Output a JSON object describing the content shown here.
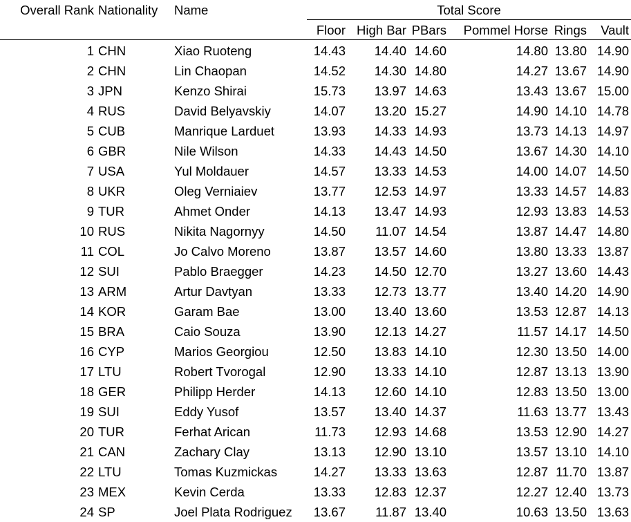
{
  "table": {
    "headers": {
      "rank": "Overall Rank",
      "nationality": "Nationality",
      "name": "Name",
      "group": "Total Score",
      "floor": "Floor",
      "highbar": "High Bar",
      "pbars": "PBars",
      "pommel": "Pommel Horse",
      "rings": "Rings",
      "vault": "Vault"
    },
    "rows": [
      {
        "rank": "1",
        "nat": "CHN",
        "name": "Xiao Ruoteng",
        "floor": "14.43",
        "highbar": "14.40",
        "pbars": "14.60",
        "pommel": "14.80",
        "rings": "13.80",
        "vault": "14.90"
      },
      {
        "rank": "2",
        "nat": "CHN",
        "name": "Lin Chaopan",
        "floor": "14.52",
        "highbar": "14.30",
        "pbars": "14.80",
        "pommel": "14.27",
        "rings": "13.67",
        "vault": "14.90"
      },
      {
        "rank": "3",
        "nat": "JPN",
        "name": "Kenzo Shirai",
        "floor": "15.73",
        "highbar": "13.97",
        "pbars": "14.63",
        "pommel": "13.43",
        "rings": "13.67",
        "vault": "15.00"
      },
      {
        "rank": "4",
        "nat": "RUS",
        "name": "David Belyavskiy",
        "floor": "14.07",
        "highbar": "13.20",
        "pbars": "15.27",
        "pommel": "14.90",
        "rings": "14.10",
        "vault": "14.78"
      },
      {
        "rank": "5",
        "nat": "CUB",
        "name": "Manrique Larduet",
        "floor": "13.93",
        "highbar": "14.33",
        "pbars": "14.93",
        "pommel": "13.73",
        "rings": "14.13",
        "vault": "14.97"
      },
      {
        "rank": "6",
        "nat": "GBR",
        "name": "Nile Wilson",
        "floor": "14.33",
        "highbar": "14.43",
        "pbars": "14.50",
        "pommel": "13.67",
        "rings": "14.30",
        "vault": "14.10"
      },
      {
        "rank": "7",
        "nat": "USA",
        "name": "Yul Moldauer",
        "floor": "14.57",
        "highbar": "13.33",
        "pbars": "14.53",
        "pommel": "14.00",
        "rings": "14.07",
        "vault": "14.50"
      },
      {
        "rank": "8",
        "nat": "UKR",
        "name": "Oleg Verniaiev",
        "floor": "13.77",
        "highbar": "12.53",
        "pbars": "14.97",
        "pommel": "13.33",
        "rings": "14.57",
        "vault": "14.83"
      },
      {
        "rank": "9",
        "nat": "TUR",
        "name": "Ahmet Onder",
        "floor": "14.13",
        "highbar": "13.47",
        "pbars": "14.93",
        "pommel": "12.93",
        "rings": "13.83",
        "vault": "14.53"
      },
      {
        "rank": "10",
        "nat": "RUS",
        "name": "Nikita Nagornyy",
        "floor": "14.50",
        "highbar": "11.07",
        "pbars": "14.54",
        "pommel": "13.87",
        "rings": "14.47",
        "vault": "14.80"
      },
      {
        "rank": "11",
        "nat": "COL",
        "name": "Jo Calvo Moreno",
        "floor": "13.87",
        "highbar": "13.57",
        "pbars": "14.60",
        "pommel": "13.80",
        "rings": "13.33",
        "vault": "13.87"
      },
      {
        "rank": "12",
        "nat": "SUI",
        "name": "Pablo Braegger",
        "floor": "14.23",
        "highbar": "14.50",
        "pbars": "12.70",
        "pommel": "13.27",
        "rings": "13.60",
        "vault": "14.43"
      },
      {
        "rank": "13",
        "nat": "ARM",
        "name": "Artur Davtyan",
        "floor": "13.33",
        "highbar": "12.73",
        "pbars": "13.77",
        "pommel": "13.40",
        "rings": "14.20",
        "vault": "14.90"
      },
      {
        "rank": "14",
        "nat": "KOR",
        "name": "Garam Bae",
        "floor": "13.00",
        "highbar": "13.40",
        "pbars": "13.60",
        "pommel": "13.53",
        "rings": "12.87",
        "vault": "14.13"
      },
      {
        "rank": "15",
        "nat": "BRA",
        "name": "Caio Souza",
        "floor": "13.90",
        "highbar": "12.13",
        "pbars": "14.27",
        "pommel": "11.57",
        "rings": "14.17",
        "vault": "14.50"
      },
      {
        "rank": "16",
        "nat": "CYP",
        "name": "Marios Georgiou",
        "floor": "12.50",
        "highbar": "13.83",
        "pbars": "14.10",
        "pommel": "12.30",
        "rings": "13.50",
        "vault": "14.00"
      },
      {
        "rank": "17",
        "nat": "LTU",
        "name": "Robert Tvorogal",
        "floor": "12.90",
        "highbar": "13.33",
        "pbars": "14.10",
        "pommel": "12.87",
        "rings": "13.13",
        "vault": "13.90"
      },
      {
        "rank": "18",
        "nat": "GER",
        "name": "Philipp Herder",
        "floor": "14.13",
        "highbar": "12.60",
        "pbars": "14.10",
        "pommel": "12.83",
        "rings": "13.50",
        "vault": "13.00"
      },
      {
        "rank": "19",
        "nat": "SUI",
        "name": "Eddy Yusof",
        "floor": "13.57",
        "highbar": "13.40",
        "pbars": "14.37",
        "pommel": "11.63",
        "rings": "13.77",
        "vault": "13.43"
      },
      {
        "rank": "20",
        "nat": "TUR",
        "name": "Ferhat Arican",
        "floor": "11.73",
        "highbar": "12.93",
        "pbars": "14.68",
        "pommel": "13.53",
        "rings": "12.90",
        "vault": "14.27"
      },
      {
        "rank": "21",
        "nat": "CAN",
        "name": "Zachary Clay",
        "floor": "13.13",
        "highbar": "12.90",
        "pbars": "13.10",
        "pommel": "13.57",
        "rings": "13.10",
        "vault": "14.10"
      },
      {
        "rank": "22",
        "nat": "LTU",
        "name": "Tomas Kuzmickas",
        "floor": "14.27",
        "highbar": "13.33",
        "pbars": "13.63",
        "pommel": "12.87",
        "rings": "11.70",
        "vault": "13.87"
      },
      {
        "rank": "23",
        "nat": "MEX",
        "name": "Kevin Cerda",
        "floor": "13.33",
        "highbar": "12.83",
        "pbars": "12.37",
        "pommel": "12.27",
        "rings": "12.40",
        "vault": "13.73"
      },
      {
        "rank": "24",
        "nat": "SP",
        "name": "Joel Plata Rodriguez",
        "floor": "13.67",
        "highbar": "11.87",
        "pbars": "13.40",
        "pommel": "10.63",
        "rings": "13.50",
        "vault": "13.63"
      }
    ]
  }
}
